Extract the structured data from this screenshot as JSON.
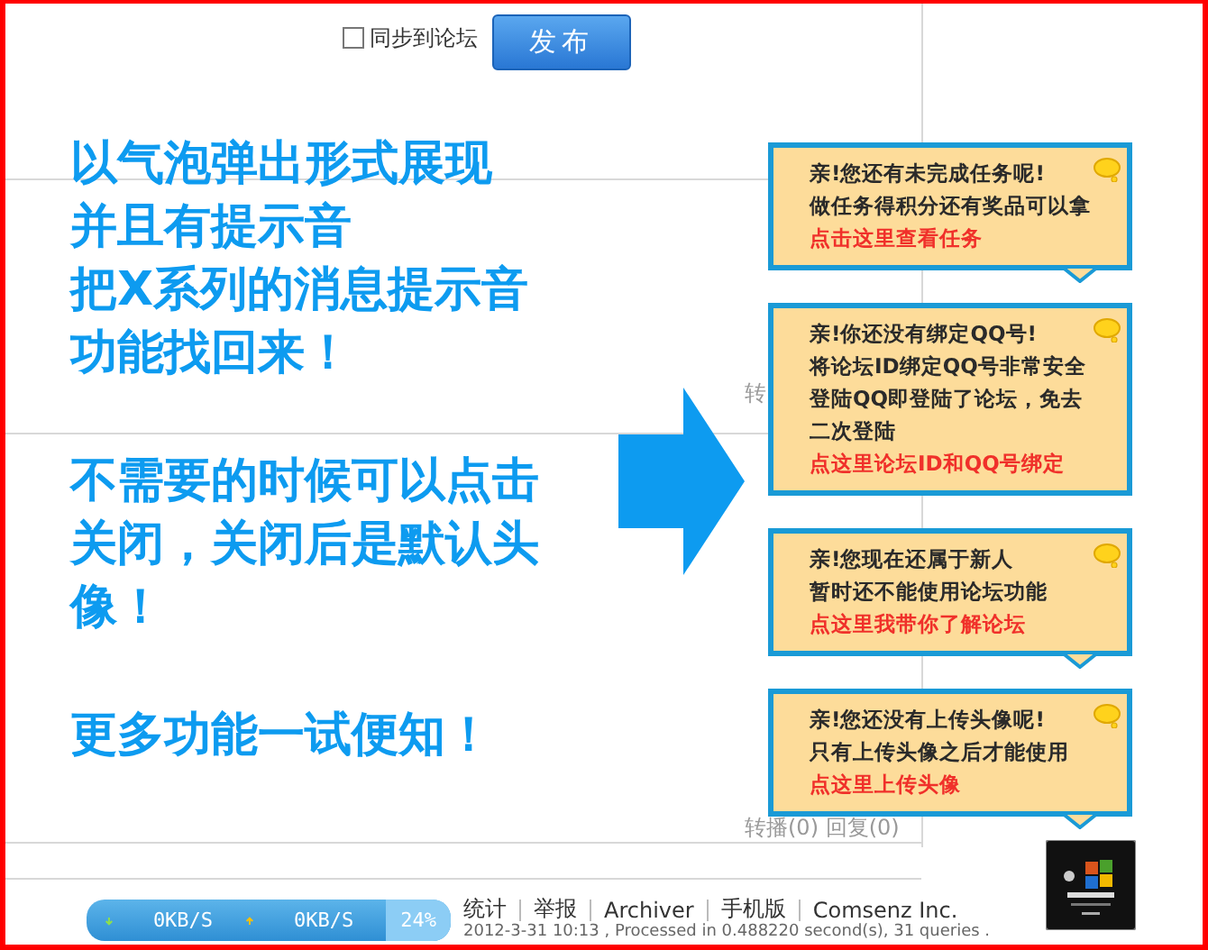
{
  "top": {
    "sync_checkbox": {
      "label": "同步到论坛",
      "checked": false
    },
    "publish_button": "发布"
  },
  "promo": {
    "paragraphs": [
      {
        "lines": [
          "以气泡弹出形式展现",
          "并且有提示音",
          "把X系列的消息提示音",
          "功能找回来！"
        ]
      },
      {
        "lines": [
          "不需要的时候可以点击",
          "关闭，关闭后是默认头",
          "像！"
        ]
      },
      {
        "lines": [
          "更多功能一试便知！"
        ]
      }
    ]
  },
  "replies": [
    "转",
    "转播(0) 回复(0)"
  ],
  "bubbles": [
    {
      "kind": "block-link",
      "lines": [
        "亲!您还有未完成任务呢!",
        "做任务得积分还有奖品可以拿"
      ],
      "link": "点击这里查看任务",
      "tail": true
    },
    {
      "kind": "block-link",
      "lines": [
        "亲!你还没有绑定QQ号!",
        "将论坛ID绑定QQ号非常安全",
        "登陆QQ即登陆了论坛，免去",
        "二次登陆"
      ],
      "link": "点这里论坛ID和QQ号绑定",
      "tail": false
    },
    {
      "kind": "block-link",
      "lines": [
        "亲!您现在还属于新人",
        "暂时还不能使用论坛功能"
      ],
      "link": "点这里我带你了解论坛",
      "tail": true
    },
    {
      "kind": "inline-link",
      "lines": [
        "亲!您还没有上传头像呢!",
        "只有上传头像之后才能使用"
      ],
      "link": "点这里上传头像",
      "tail": true
    }
  ],
  "footer": {
    "links": [
      "统计",
      "举报",
      "Archiver",
      "手机版",
      "Comsenz Inc."
    ],
    "info": "2012-3-31 10:13 , Processed in 0.488220 second(s), 31 queries ."
  },
  "speed_widget": {
    "download": "0KB/S",
    "upload": "0KB/S",
    "cpu": "24%"
  },
  "thumbnail": {
    "kind": "picture"
  }
}
